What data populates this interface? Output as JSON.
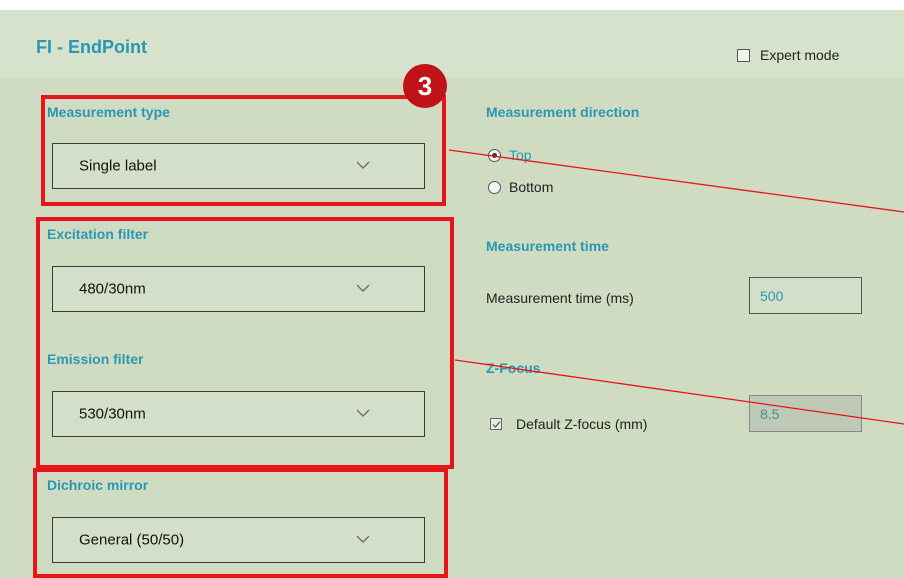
{
  "panel": {
    "title": "FI - EndPoint"
  },
  "expert_mode": {
    "label": "Expert mode",
    "checked": false
  },
  "badge": {
    "number": "3"
  },
  "left": {
    "measurement_type": {
      "label": "Measurement type",
      "value": "Single label"
    },
    "excitation_filter": {
      "label": "Excitation filter",
      "value": "480/30nm"
    },
    "emission_filter": {
      "label": "Emission filter",
      "value": "530/30nm"
    },
    "dichroic_mirror": {
      "label": "Dichroic mirror",
      "value": "General (50/50)"
    }
  },
  "right": {
    "measurement_direction": {
      "label": "Measurement direction",
      "options": [
        {
          "label": "Top",
          "selected": true
        },
        {
          "label": "Bottom",
          "selected": false
        }
      ]
    },
    "measurement_time": {
      "label": "Measurement time",
      "field_label": "Measurement time (ms)",
      "value": "500"
    },
    "z_focus": {
      "label": "Z-Focus",
      "checkbox_label": "Default Z-focus (mm)",
      "checked": true,
      "value": "8.5"
    }
  },
  "colors": {
    "accent": "#2a97b3",
    "highlight_box": "#e8141c",
    "badge": "#c1121a",
    "panel_bg": "#cfdcc2"
  },
  "icons": {
    "dropdown": "chevron-down-icon",
    "checkbox": "checkmark-icon"
  }
}
